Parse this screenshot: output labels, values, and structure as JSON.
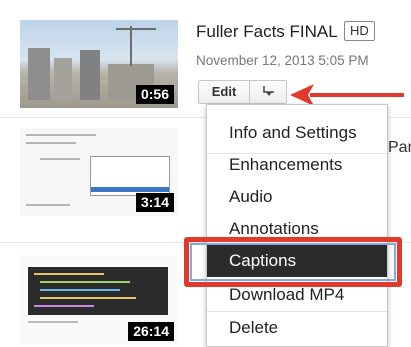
{
  "videos": [
    {
      "duration": "0:56",
      "title": "Fuller Facts FINAL",
      "badge": "HD",
      "date": "November 12, 2013 5:05 PM"
    },
    {
      "duration": "3:14",
      "title_fragment": "Part"
    },
    {
      "duration": "26:14"
    }
  ],
  "edit_label": "Edit",
  "menu": {
    "items": [
      {
        "label": "Info and Settings"
      },
      {
        "label": "Enhancements"
      },
      {
        "label": "Audio"
      },
      {
        "label": "Annotations"
      },
      {
        "label": "Captions"
      },
      {
        "label": "Download MP4"
      },
      {
        "label": "Delete"
      }
    ],
    "selected": "Captions"
  },
  "colors": {
    "highlight_border": "#e03a2c",
    "arrow": "#e03a2c",
    "selected_bg": "#2b2b2b",
    "selected_text": "#ffffff"
  },
  "icons": {
    "dropdown": "chevron-down-icon",
    "pointer": "red-arrow-icon"
  }
}
